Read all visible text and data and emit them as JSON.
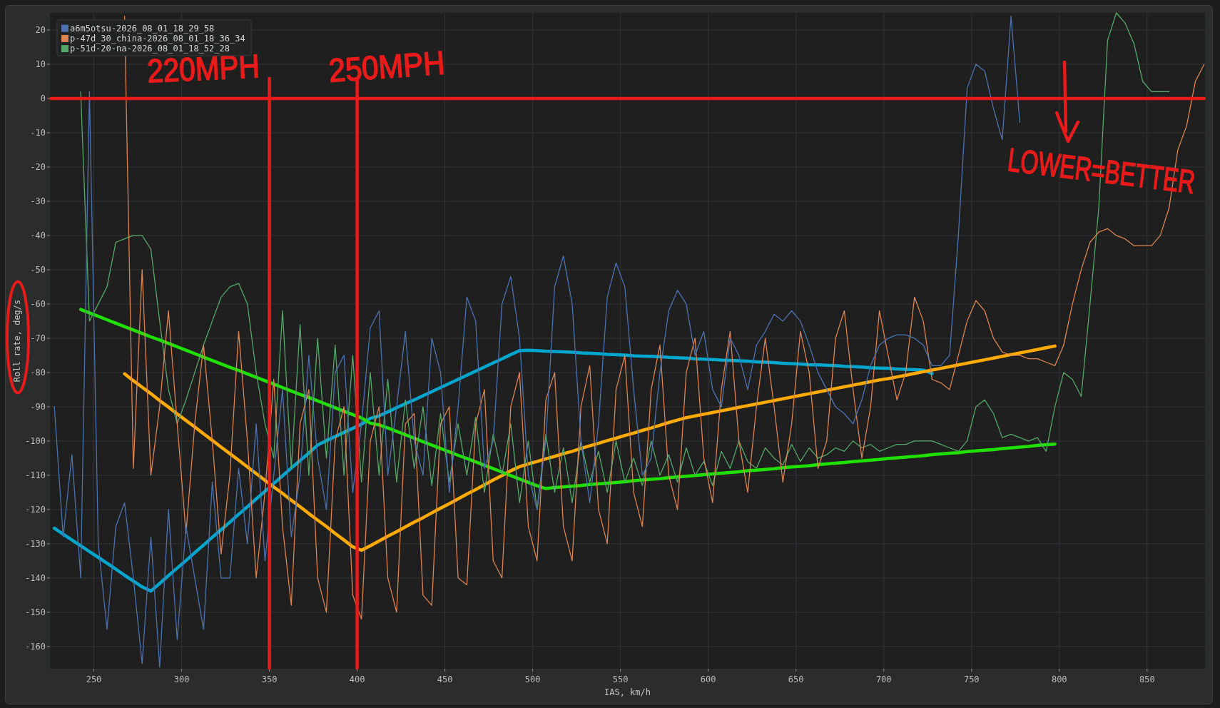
{
  "plot": {
    "chart_data": {
      "type": "line",
      "xlabel": "IAS, km/h",
      "ylabel": "Roll rate, deg/s",
      "x": [
        227.5,
        232.5,
        237.5,
        242.5,
        247.5,
        252.5,
        257.5,
        262.5,
        267.5,
        272.5,
        277.5,
        282.5,
        287.5,
        292.5,
        297.5,
        302.5,
        307.5,
        312.5,
        317.5,
        322.5,
        327.5,
        332.5,
        337.5,
        342.5,
        347.5,
        352.5,
        357.5,
        362.5,
        367.5,
        372.5,
        377.5,
        382.5,
        387.5,
        392.5,
        397.5,
        402.5,
        407.5,
        412.5,
        417.5,
        422.5,
        427.5,
        432.5,
        437.5,
        442.5,
        447.5,
        452.5,
        457.5,
        462.5,
        467.5,
        472.5,
        477.5,
        482.5,
        487.5,
        492.5,
        497.5,
        502.5,
        507.5,
        512.5,
        517.5,
        522.5,
        527.5,
        532.5,
        537.5,
        542.5,
        547.5,
        552.5,
        557.5,
        562.5,
        567.5,
        572.5,
        577.5,
        582.5,
        587.5,
        592.5,
        597.5,
        602.5,
        607.5,
        612.5,
        617.5,
        622.5,
        627.5,
        632.5,
        637.5,
        642.5,
        647.5,
        652.5,
        657.5,
        662.5,
        667.5,
        672.5,
        677.5,
        682.5,
        687.5,
        692.5,
        697.5,
        702.5,
        707.5,
        712.5,
        717.5,
        722.5,
        727.5,
        732.5,
        737.5,
        742.5,
        747.5,
        752.5,
        757.5,
        762.5,
        767.5,
        772.5,
        777.5,
        782.5,
        787.5,
        792.5,
        797.5,
        802.5,
        807.5,
        812.5,
        817.5,
        822.5,
        827.5,
        832.5,
        837.5,
        842.5,
        847.5,
        852.5,
        857.5,
        862.5,
        867.5,
        872.5,
        877.5,
        882.5
      ],
      "series": [
        {
          "name": "a6m5otsu-2026_08_01_18_29_58",
          "color": "#4c72b0",
          "values": [
            -90,
            -128,
            -104,
            -140,
            2,
            -130,
            -155,
            -125,
            -118,
            -140,
            -165,
            -128,
            -166,
            -120,
            -158,
            -125,
            -140,
            -155,
            -112,
            -140,
            -140,
            -108,
            -130,
            -95,
            -135,
            -110,
            -85,
            -128,
            -110,
            -75,
            -105,
            -120,
            -80,
            -75,
            -115,
            -95,
            -67,
            -62,
            -110,
            -90,
            -68,
            -100,
            -110,
            -70,
            -80,
            -115,
            -90,
            -58,
            -65,
            -108,
            -100,
            -60,
            -52,
            -70,
            -110,
            -120,
            -100,
            -55,
            -46,
            -60,
            -100,
            -118,
            -95,
            -58,
            -48,
            -55,
            -85,
            -110,
            -105,
            -80,
            -62,
            -56,
            -60,
            -75,
            -68,
            -85,
            -90,
            -70,
            -75,
            -85,
            -72,
            -68,
            -63,
            -65,
            -62,
            -65,
            -72,
            -80,
            -85,
            -90,
            -92,
            -95,
            -88,
            -78,
            -72,
            -70,
            -69,
            -69,
            -70,
            -72,
            -78,
            -78,
            -75,
            -40,
            3,
            10,
            8,
            -3,
            -12,
            24,
            -7,
            null,
            null,
            null,
            null,
            null,
            null,
            null,
            null,
            null,
            null,
            null,
            null,
            null,
            null,
            null,
            null,
            null,
            null,
            null,
            null,
            null
          ]
        },
        {
          "name": "p-47d_30_china-2026_08_01_18_36_34",
          "color": "#dd8452",
          "values": [
            null,
            null,
            null,
            null,
            null,
            null,
            null,
            null,
            24,
            -108,
            -50,
            -110,
            -90,
            -62,
            -95,
            -127,
            -95,
            -72,
            -100,
            -133,
            -110,
            -68,
            -100,
            -140,
            -115,
            -82,
            -125,
            -148,
            -95,
            -85,
            -140,
            -150,
            -100,
            -90,
            -145,
            -152,
            -100,
            -90,
            -140,
            -150,
            -95,
            -92,
            -145,
            -148,
            -95,
            -90,
            -140,
            -142,
            -95,
            -85,
            -135,
            -140,
            -90,
            -80,
            -125,
            -135,
            -88,
            -80,
            -125,
            -135,
            -90,
            -78,
            -120,
            -130,
            -85,
            -75,
            -115,
            -125,
            -85,
            -72,
            -110,
            -120,
            -80,
            -70,
            -105,
            -118,
            -85,
            -68,
            -100,
            -115,
            -90,
            -70,
            -90,
            -112,
            -95,
            -68,
            -80,
            -108,
            -100,
            -70,
            -62,
            -85,
            -105,
            -90,
            -62,
            -75,
            -88,
            -80,
            -58,
            -65,
            -82,
            -83,
            -85,
            -75,
            -65,
            -59,
            -62,
            -70,
            -74,
            -75,
            -75,
            -76,
            -76,
            -77,
            -78,
            -72,
            -60,
            -50,
            -42,
            -39,
            -38,
            -40,
            -41,
            -43,
            -43,
            -43,
            -40,
            -32,
            -15,
            -8,
            5,
            10
          ]
        },
        {
          "name": "p-51d-20-na-2026_08_01_18_52_28",
          "color": "#55a868",
          "values": [
            null,
            null,
            null,
            2,
            -65,
            -60,
            -55,
            -42,
            -41,
            -40,
            -40,
            -44,
            -65,
            -85,
            -95,
            -88,
            -80,
            -72,
            -65,
            -58,
            -55,
            -54,
            -60,
            -80,
            -95,
            -105,
            -62,
            -108,
            -66,
            -110,
            -70,
            -105,
            -72,
            -110,
            -75,
            -112,
            -80,
            -110,
            -82,
            -112,
            -88,
            -108,
            -90,
            -113,
            -92,
            -112,
            -95,
            -110,
            -93,
            -115,
            -98,
            -110,
            -95,
            -118,
            -100,
            -120,
            -98,
            -115,
            -102,
            -118,
            -100,
            -112,
            -103,
            -115,
            -100,
            -112,
            -105,
            -113,
            -100,
            -110,
            -104,
            -112,
            -102,
            -110,
            -106,
            -113,
            -103,
            -108,
            -100,
            -106,
            -108,
            -102,
            -105,
            -107,
            -101,
            -106,
            -102,
            -105,
            -104,
            -102,
            -103,
            -100,
            -102,
            -101,
            -103,
            -102,
            -101,
            -101,
            -100,
            -100,
            -100,
            -101,
            -102,
            -103,
            -100,
            -90,
            -88,
            -92,
            -99,
            -98,
            -99,
            -100,
            -99,
            -103,
            -90,
            -80,
            -82,
            -87,
            -60,
            -32,
            17,
            25,
            22,
            16,
            5,
            2,
            2,
            2,
            null,
            null,
            null,
            null
          ]
        },
        {
          "color": "#1fe000",
          "values": [
            null,
            null,
            null,
            -61.6,
            -62.6,
            -63.6,
            -64.6,
            -65.6,
            -66.6,
            -67.6,
            -68.6,
            -69.6,
            -70.5,
            -71.5,
            -72.5,
            -73.5,
            -74.5,
            -75.5,
            -76.5,
            -77.5,
            -78.5,
            -79.4,
            -80.4,
            -81.4,
            -82.4,
            -83.4,
            -84.4,
            -85.4,
            -86.4,
            -87.3,
            -88.3,
            -89.3,
            -90.3,
            -91.3,
            -92.3,
            -93.3,
            -94.8,
            -95.3,
            -96.2,
            -97.2,
            -98.2,
            -99.2,
            -100.2,
            -101.2,
            -102.2,
            -103.2,
            -104.2,
            -105.1,
            -106.1,
            -107.1,
            -108.1,
            -109.1,
            -110.1,
            -111.1,
            -112.1,
            -113.1,
            -113.9,
            -113.6,
            -113.4,
            -113.2,
            -113.0,
            -112.7,
            -112.5,
            -112.3,
            -112.1,
            -111.9,
            -111.6,
            -111.4,
            -111.2,
            -111.0,
            -110.7,
            -110.5,
            -110.3,
            -110.1,
            -109.8,
            -109.6,
            -109.4,
            -109.2,
            -109.0,
            -108.7,
            -108.5,
            -108.3,
            -108.1,
            -107.8,
            -107.6,
            -107.4,
            -107.2,
            -106.9,
            -106.7,
            -106.5,
            -106.3,
            -106.0,
            -105.8,
            -105.6,
            -105.4,
            -105.1,
            -104.9,
            -104.7,
            -104.5,
            -104.3,
            -104.0,
            -103.8,
            -103.6,
            -103.4,
            -103.1,
            -102.9,
            -102.7,
            -102.5,
            -102.2,
            -102.0,
            -101.8,
            -101.6,
            -101.3,
            -101.1,
            -100.9,
            null,
            null,
            null,
            null,
            null,
            null,
            null,
            null,
            null,
            null,
            null,
            null,
            null,
            null,
            null,
            null,
            null
          ]
        },
        {
          "color": "#ffaa00",
          "values": [
            null,
            null,
            null,
            null,
            null,
            null,
            null,
            null,
            -80.4,
            -82.4,
            -84.3,
            -86.2,
            -88.2,
            -90.1,
            -92.1,
            -94.0,
            -95.9,
            -97.9,
            -99.8,
            -101.8,
            -103.7,
            -105.6,
            -107.6,
            -109.5,
            -111.5,
            -113.4,
            -115.3,
            -117.3,
            -119.2,
            -121.2,
            -123.1,
            -125.0,
            -127.0,
            -128.9,
            -130.9,
            -131.9,
            -130.6,
            -129.2,
            -127.8,
            -126.5,
            -125.1,
            -123.7,
            -122.4,
            -121.0,
            -119.6,
            -118.3,
            -116.9,
            -115.5,
            -114.2,
            -112.8,
            -111.4,
            -110.1,
            -108.7,
            -107.5,
            -106.7,
            -106.0,
            -105.2,
            -104.5,
            -103.7,
            -103.0,
            -102.2,
            -101.4,
            -100.7,
            -99.9,
            -99.2,
            -98.4,
            -97.7,
            -96.9,
            -96.2,
            -95.4,
            -94.6,
            -93.9,
            -93.2,
            -92.7,
            -92.2,
            -91.7,
            -91.2,
            -90.7,
            -90.2,
            -89.7,
            -89.2,
            -88.7,
            -88.2,
            -87.7,
            -87.2,
            -86.7,
            -86.2,
            -85.7,
            -85.2,
            -84.7,
            -84.2,
            -83.7,
            -83.2,
            -82.7,
            -82.2,
            -81.8,
            -81.3,
            -80.8,
            -80.3,
            -79.8,
            -79.3,
            -78.8,
            -78.3,
            -77.8,
            -77.3,
            -76.8,
            -76.3,
            -75.8,
            -75.3,
            -74.8,
            -74.3,
            -73.8,
            -73.3,
            -72.8,
            -72.3,
            null,
            null,
            null,
            null,
            null,
            null,
            null,
            null,
            null,
            null,
            null,
            null,
            null,
            null,
            null,
            null,
            null
          ]
        },
        {
          "color": "#00a6cc",
          "values": [
            -125.5,
            -127.2,
            -128.9,
            -130.6,
            -132.3,
            -134.0,
            -135.7,
            -137.4,
            -139.2,
            -140.9,
            -142.6,
            -143.8,
            -141.6,
            -139.3,
            -137.1,
            -134.9,
            -132.6,
            -130.4,
            -128.1,
            -125.9,
            -123.7,
            -121.4,
            -119.2,
            -116.9,
            -114.7,
            -112.4,
            -110.2,
            -107.9,
            -105.7,
            -103.5,
            -101.2,
            -99.9,
            -98.7,
            -97.5,
            -96.3,
            -95.1,
            -93.4,
            -92.7,
            -91.5,
            -90.3,
            -89.1,
            -88.0,
            -86.8,
            -85.6,
            -84.4,
            -83.2,
            -82.0,
            -80.8,
            -79.6,
            -78.4,
            -77.2,
            -76.0,
            -74.8,
            -73.6,
            -73.5,
            -73.6,
            -73.8,
            -73.9,
            -74.0,
            -74.1,
            -74.3,
            -74.4,
            -74.5,
            -74.7,
            -74.8,
            -74.9,
            -75.1,
            -75.2,
            -75.3,
            -75.4,
            -75.6,
            -75.7,
            -75.8,
            -76.0,
            -76.1,
            -76.2,
            -76.4,
            -76.5,
            -76.6,
            -76.7,
            -76.9,
            -77.0,
            -77.1,
            -77.3,
            -77.4,
            -77.5,
            -77.7,
            -77.8,
            -77.9,
            -78.0,
            -78.2,
            -78.3,
            -78.4,
            -78.6,
            -78.7,
            -78.8,
            -79.0,
            -79.1,
            -79.2,
            -79.3,
            -80.3,
            null,
            null,
            null,
            null,
            null,
            null,
            null,
            null,
            null,
            null,
            null,
            null,
            null,
            null,
            null,
            null,
            null,
            null,
            null,
            null,
            null,
            null,
            null,
            null,
            null,
            null,
            null,
            null,
            null,
            null,
            null
          ]
        }
      ],
      "xlim": [
        225,
        883
      ],
      "ylim": [
        -166.5,
        25
      ],
      "xticks": [
        250,
        300,
        350,
        400,
        450,
        500,
        550,
        600,
        650,
        700,
        750,
        800,
        850
      ],
      "yticks": [
        20,
        10,
        0,
        -10,
        -20,
        -30,
        -40,
        -50,
        -60,
        -70,
        -80,
        -90,
        -100,
        -110,
        -120,
        -130,
        -140,
        -150,
        -160
      ],
      "legend": "upper left",
      "ref_lines": [
        {
          "axis": "y",
          "value": 0,
          "color": "#e81b1b"
        },
        {
          "axis": "x",
          "value": 350,
          "color": "#e81b1b"
        },
        {
          "axis": "x",
          "value": 400,
          "color": "#e81b1b"
        }
      ],
      "annotations": [
        "220MPH",
        "250MPH",
        "LOWER=BETTER"
      ]
    }
  }
}
